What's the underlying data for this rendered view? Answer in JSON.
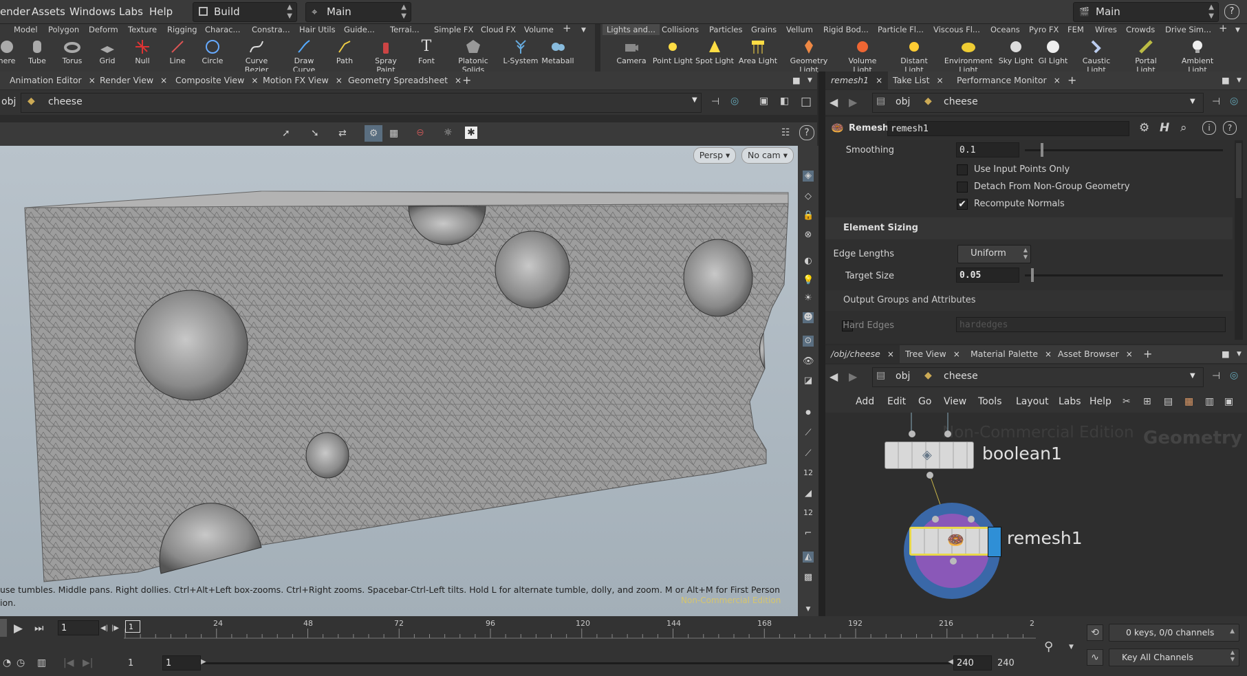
{
  "menubar": {
    "items": [
      "ender",
      "Assets",
      "Windows",
      "Labs",
      "Help"
    ],
    "desktop_label": "Build",
    "context_label": "Main",
    "right_desk_label": "Main"
  },
  "shelf_left": {
    "tabs": [
      "Model",
      "Polygon",
      "Deform",
      "Texture",
      "Rigging",
      "Charac...",
      "Constra...",
      "Hair Utils",
      "Guide...",
      "Terrai...",
      "Simple FX",
      "Cloud FX",
      "Volume"
    ],
    "tools": [
      "here",
      "Tube",
      "Torus",
      "Grid",
      "Null",
      "Line",
      "Circle",
      "Curve Bezier",
      "Draw Curve",
      "Path",
      "Spray Paint",
      "Font",
      "Platonic Solids",
      "L-System",
      "Metaball"
    ]
  },
  "shelf_right": {
    "tabs": [
      "Lights and...",
      "Collisions",
      "Particles",
      "Grains",
      "Vellum",
      "Rigid Bod...",
      "Particle Fl...",
      "Viscous Fl...",
      "Oceans",
      "Pyro FX",
      "FEM",
      "Wires",
      "Crowds",
      "Drive Sim..."
    ],
    "tools": [
      "Camera",
      "Point Light",
      "Spot Light",
      "Area Light",
      "Geometry Light",
      "Volume Light",
      "Distant Light",
      "Environment Light",
      "Sky Light",
      "GI Light",
      "Caustic Light",
      "Portal Light",
      "Ambient Light"
    ]
  },
  "left_pane": {
    "tabs": [
      "Animation Editor",
      "Render View",
      "Composite View",
      "Motion FX View",
      "Geometry Spreadsheet"
    ],
    "path_obj": "obj",
    "path_node": "cheese",
    "persp_label": "Persp",
    "cam_label": "No cam",
    "hint_line1": "use tumbles. Middle pans. Right dollies. Ctrl+Alt+Left box-zooms. Ctrl+Right zooms. Spacebar-Ctrl-Left tilts. Hold L for alternate tumble, dolly, and zoom.    M or Alt+M for First Person",
    "hint_line2": "ion.",
    "watermark": "Non-Commercial Edition"
  },
  "parm_pane": {
    "tabs": [
      "remesh1",
      "Take List",
      "Performance Monitor"
    ],
    "path_obj": "obj",
    "path_node": "cheese",
    "node_type": "Remesh",
    "node_name": "remesh1",
    "smoothing_label": "Smoothing",
    "smoothing_value": "0.1",
    "smoothing_fraction": 0.08,
    "checkboxes": [
      {
        "label": "Use Input Points Only",
        "checked": false
      },
      {
        "label": "Detach From Non-Group Geometry",
        "checked": false
      },
      {
        "label": "Recompute Normals",
        "checked": true
      }
    ],
    "section_element_sizing": "Element Sizing",
    "edge_lengths_label": "Edge Lengths",
    "edge_lengths_value": "Uniform",
    "target_size_label": "Target Size",
    "target_size_value": "0.05",
    "target_size_fraction": 0.03,
    "section_output": "Output Groups and Attributes",
    "hard_edges_label": "Hard Edges",
    "hard_edges_placeholder": "hardedges"
  },
  "network_pane": {
    "tabs": [
      "/obj/cheese",
      "Tree View",
      "Material Palette",
      "Asset Browser"
    ],
    "path_obj": "obj",
    "path_node": "cheese",
    "menu": [
      "Add",
      "Edit",
      "Go",
      "View",
      "Tools",
      "Layout",
      "Labs",
      "Help"
    ],
    "watermark": "Non-Commercial Edition",
    "context_label": "Geometry",
    "nodes": [
      "boolean1",
      "remesh1"
    ]
  },
  "timeline": {
    "current_frame": "1",
    "ticks": [
      "24",
      "48",
      "72",
      "96",
      "120",
      "144",
      "168",
      "192",
      "216",
      "2"
    ],
    "range_start": "1",
    "range_start2": "1",
    "range_end": "240",
    "range_end2": "240",
    "keys_label": "0 keys, 0/0 channels",
    "key_all_label": "Key All Channels",
    "frame_marker": "1"
  },
  "colors": {
    "accent_blue": "#2f8fd6",
    "node_selected": "#e8d84a",
    "viewport_bg": "#b3bec6"
  }
}
